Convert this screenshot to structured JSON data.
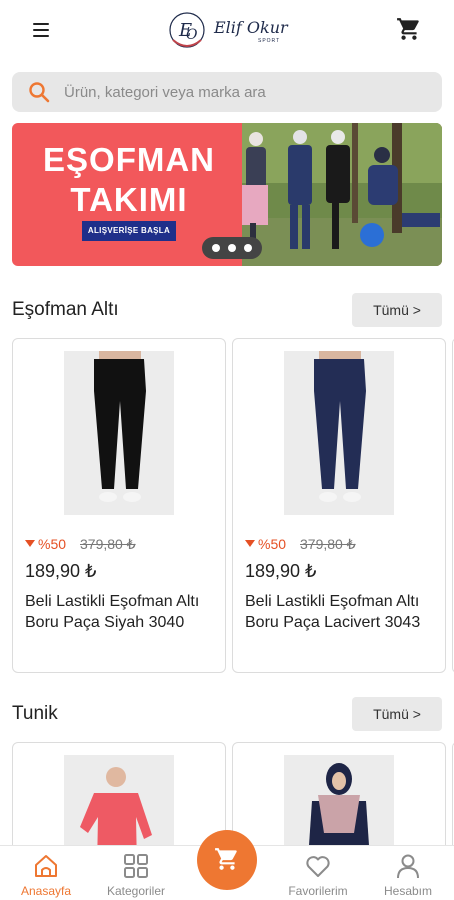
{
  "header": {
    "logo_script": "Elif Okur",
    "logo_sub": "SPORT",
    "menu_icon": "menu-icon",
    "cart_icon": "cart-icon"
  },
  "search": {
    "placeholder": "Ürün, kategori veya marka ara",
    "icon": "search-icon",
    "accent": "#ee7732"
  },
  "banner": {
    "title_line1": "EŞOFMAN",
    "title_line2": "TAKIMI",
    "cta": "ALIŞVERİŞE BAŞLA",
    "background": "#f2585b",
    "slide_count": 3
  },
  "sections": [
    {
      "title": "Eşofman Altı",
      "all_label": "Tümü >",
      "products": [
        {
          "discount": "%50",
          "old_price": "379,80 ₺",
          "price": "189,90 ₺",
          "name": "Beli Lastikli Eşofman Altı Boru Paça Siyah 3040",
          "color": "#111111"
        },
        {
          "discount": "%50",
          "old_price": "379,80 ₺",
          "price": "189,90 ₺",
          "name": "Beli Lastikli Eşofman Altı Boru Paça Lacivert 3043",
          "color": "#232d55"
        }
      ]
    },
    {
      "title": "Tunik",
      "all_label": "Tümü >",
      "products": [
        {
          "color": "#ee5a64"
        },
        {
          "color": "#1e2546"
        }
      ]
    }
  ],
  "bottom_nav": {
    "items": [
      {
        "label": "Anasayfa",
        "icon": "home-icon",
        "active": true
      },
      {
        "label": "Kategoriler",
        "icon": "grid-icon",
        "active": false
      },
      {
        "label": "Favorilerim",
        "icon": "heart-icon",
        "active": false
      },
      {
        "label": "Hesabım",
        "icon": "person-icon",
        "active": false
      }
    ],
    "center_icon": "cart-icon",
    "accent": "#ee7732"
  }
}
